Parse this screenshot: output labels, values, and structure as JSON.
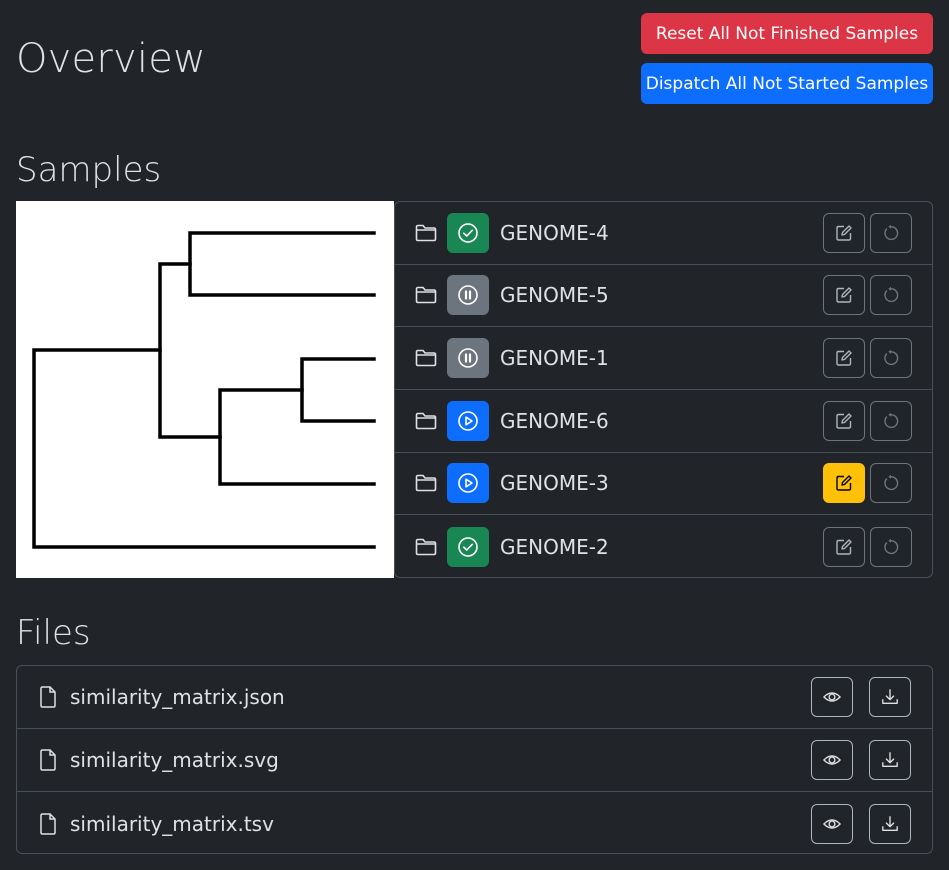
{
  "page": {
    "title": "Overview"
  },
  "actions": {
    "reset_label": "Reset All Not Finished Samples",
    "dispatch_label": "Dispatch All Not Started Samples"
  },
  "samples": {
    "title": "Samples",
    "items": [
      {
        "name": "GENOME-4",
        "status": "finished",
        "status_icon": "check-circle-icon",
        "status_color": "#198754",
        "edit_active": false
      },
      {
        "name": "GENOME-5",
        "status": "paused",
        "status_icon": "pause-circle-icon",
        "status_color": "#6c757d",
        "edit_active": false
      },
      {
        "name": "GENOME-1",
        "status": "paused",
        "status_icon": "pause-circle-icon",
        "status_color": "#6c757d",
        "edit_active": false
      },
      {
        "name": "GENOME-6",
        "status": "running",
        "status_icon": "play-circle-icon",
        "status_color": "#0d6efd",
        "edit_active": false
      },
      {
        "name": "GENOME-3",
        "status": "running",
        "status_icon": "play-circle-icon",
        "status_color": "#0d6efd",
        "edit_active": true
      },
      {
        "name": "GENOME-2",
        "status": "finished",
        "status_icon": "check-circle-icon",
        "status_color": "#198754",
        "edit_active": false
      }
    ]
  },
  "files": {
    "title": "Files",
    "items": [
      {
        "name": "similarity_matrix.json"
      },
      {
        "name": "similarity_matrix.svg"
      },
      {
        "name": "similarity_matrix.tsv"
      }
    ]
  },
  "colors": {
    "background": "#212529",
    "danger": "#dc3545",
    "primary": "#0d6efd",
    "success": "#198754",
    "secondary": "#6c757d",
    "warning": "#ffc107"
  }
}
